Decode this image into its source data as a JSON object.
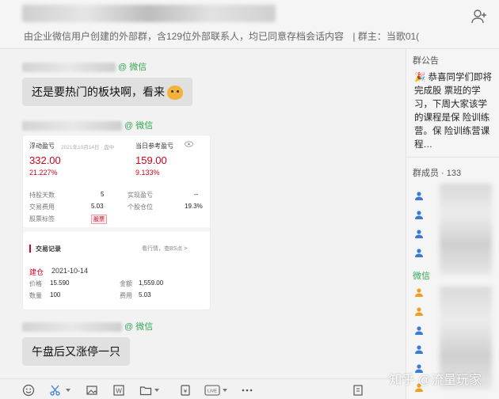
{
  "header": {
    "subtitle": "由企业微信用户创建的外部群，含129位外部联系人，均已同意存档会话内容",
    "owner": "| 群主：当歌01("
  },
  "messages": [
    {
      "sender_tag": "@ 微信",
      "text": "还是要热门的板块啊，看来"
    },
    {
      "sender_tag": "@ 微信"
    },
    {
      "sender_tag": "@ 微信",
      "text": "午盘后又涨停一只"
    }
  ],
  "trade_card": {
    "float_pl_label": "浮动盈亏",
    "float_pl_date": "2021年10月14日 · 盘中",
    "float_pl_value": "332.00",
    "float_pl_pct": "21.227%",
    "today_ref_label": "当日参考盈亏",
    "today_ref_value": "159.00",
    "today_ref_pct": "9.133%",
    "rows": [
      {
        "label": "持股天数",
        "value": "5",
        "label2": "实现盈亏",
        "value2": "--"
      },
      {
        "label": "交易费用",
        "value": "5.03",
        "label2": "个股仓位",
        "value2": "19.3%"
      },
      {
        "label": "股票标签",
        "tag": "股票"
      }
    ],
    "records_label": "交易记录",
    "records_link": "看行情，查BS点 >",
    "record_type": "建仓",
    "record_date": "2021-10-14",
    "price_label": "价格",
    "price_value": "15.590",
    "amount_label": "金额",
    "amount_value": "1,559.00",
    "qty_label": "数量",
    "qty_value": "100",
    "fee_label": "费用",
    "fee_value": "5.03"
  },
  "sidebar": {
    "notice_title": "群公告",
    "notice_text": "🎉 恭喜同学们即将完成股 票班的学习，下周大家该学的课程是保 险训练营。保 险训练营课程…",
    "members_title": "群成员 · 133",
    "wechat_label": "微信"
  },
  "watermark": "知乎 @流量玩家",
  "colors": {
    "accent_red": "#d0021b",
    "wechat_green": "#34a853",
    "member_blue": "#3a7bd5",
    "member_orange": "#f0a020"
  }
}
